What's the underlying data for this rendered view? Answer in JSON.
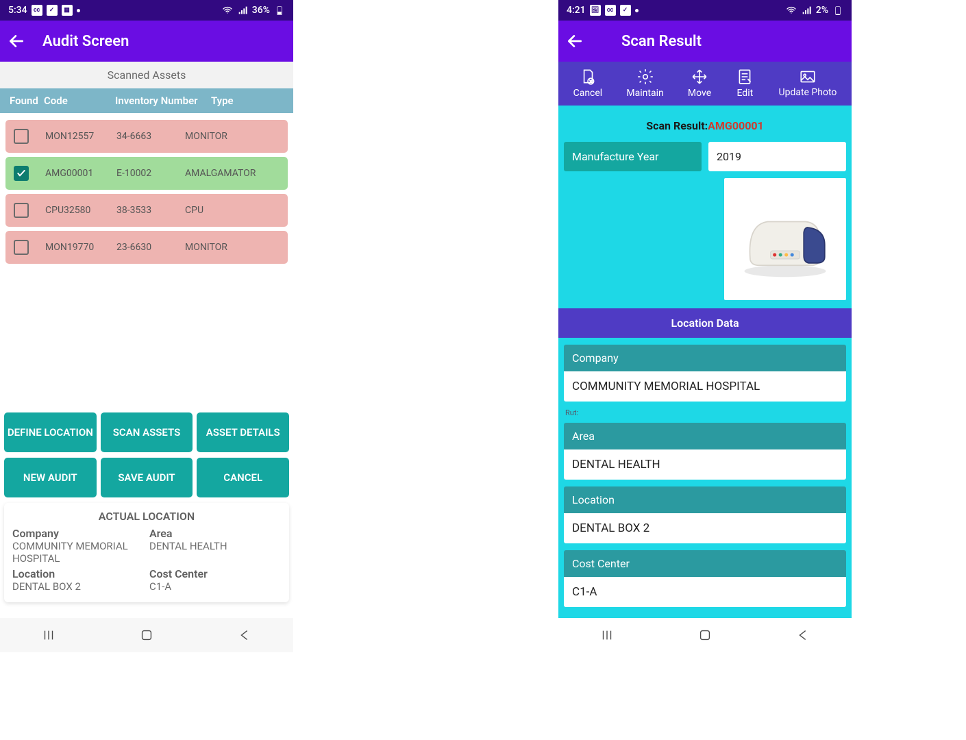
{
  "left": {
    "statusbar": {
      "time": "5:34",
      "battery": "36%"
    },
    "appbar": {
      "title": "Audit Screen"
    },
    "scanned_label": "Scanned Assets",
    "table": {
      "headers": {
        "found": "Found",
        "code": "Code",
        "inv": "Inventory Number",
        "type": "Type"
      },
      "rows": [
        {
          "checked": false,
          "code": "MON12557",
          "inv": "34-6663",
          "type": "MONITOR",
          "status": "red"
        },
        {
          "checked": true,
          "code": "AMG00001",
          "inv": "E-10002",
          "type": "AMALGAMATOR",
          "status": "green"
        },
        {
          "checked": false,
          "code": "CPU32580",
          "inv": "38-3533",
          "type": "CPU",
          "status": "red"
        },
        {
          "checked": false,
          "code": "MON19770",
          "inv": "23-6630",
          "type": "MONITOR",
          "status": "red"
        }
      ]
    },
    "buttons": {
      "define_location": "DEFINE LOCATION",
      "scan_assets": "SCAN ASSETS",
      "asset_details": "ASSET DETAILS",
      "new_audit": "NEW AUDIT",
      "save_audit": "SAVE AUDIT",
      "cancel": "CANCEL"
    },
    "location_card": {
      "title": "ACTUAL LOCATION",
      "company_label": "Company",
      "company": "COMMUNITY MEMORIAL HOSPITAL",
      "area_label": "Area",
      "area": "DENTAL HEALTH",
      "location_label": "Location",
      "location": "DENTAL BOX 2",
      "cc_label": "Cost Center",
      "cc": "C1-A"
    }
  },
  "right": {
    "statusbar": {
      "time": "4:21",
      "battery": "2%"
    },
    "appbar": {
      "title": "Scan Result"
    },
    "toolbar": {
      "cancel": "Cancel",
      "maintain": "Maintain",
      "move": "Move",
      "edit": "Edit",
      "update_photo": "Update Photo"
    },
    "scan_result_label": "Scan Result:",
    "scan_result_code": "AMG00001",
    "manufacture_year_label": "Manufacture Year",
    "manufacture_year": "2019",
    "location_data_section": "Location Data",
    "fields": {
      "company_label": "Company",
      "company": "COMMUNITY MEMORIAL HOSPITAL",
      "rut_label": "Rut:",
      "area_label": "Area",
      "area": "DENTAL HEALTH",
      "location_label": "Location",
      "location": "DENTAL BOX 2",
      "cc_label": "Cost Center",
      "cc": "C1-A"
    }
  }
}
